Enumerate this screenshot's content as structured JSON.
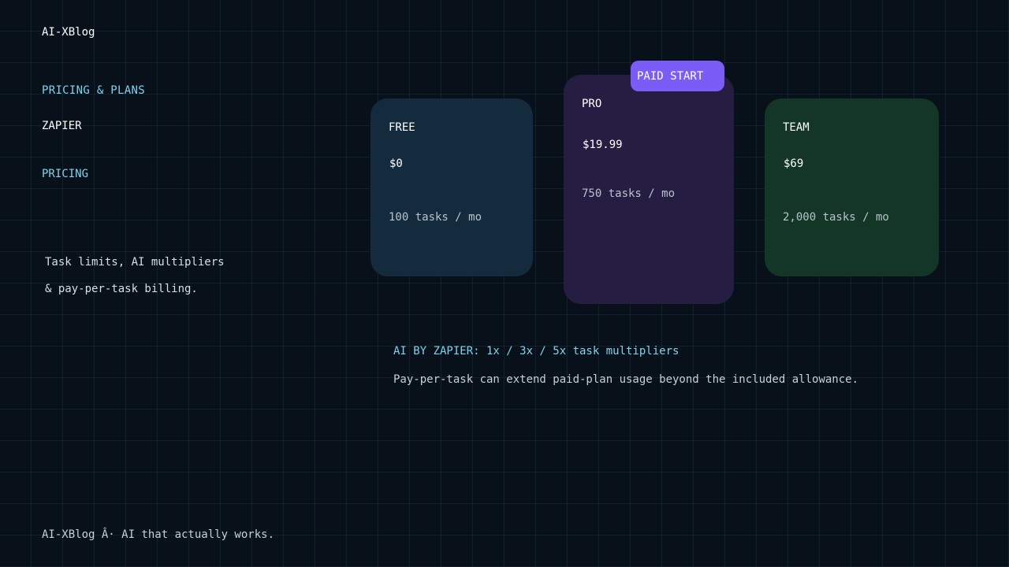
{
  "brand": {
    "name": "AI-XBlog"
  },
  "sidebar": {
    "kicker": "PRICING & PLANS",
    "title_line1": "ZAPIER",
    "title_line2": "PRICING",
    "description_lines": [
      "Task limits, AI multipliers",
      "& pay-per-task billing."
    ]
  },
  "plans": [
    {
      "name": "FREE",
      "price": "$0",
      "tasks": "100 tasks / mo",
      "color": "#142b3d"
    },
    {
      "name": "PRO",
      "price": "$19.99",
      "tasks": "750 tasks / mo",
      "color": "#261e42",
      "badge": "PAID START",
      "badge_color": "#7c5cf7"
    },
    {
      "name": "TEAM",
      "price": "$69",
      "tasks": "2,000 tasks / mo",
      "color": "#133626"
    }
  ],
  "ai_note": {
    "heading": "AI BY ZAPIER: 1x / 3x / 5x task multipliers",
    "body": "Pay-per-task can extend paid-plan usage beyond the included allowance."
  },
  "footer": {
    "text": "AI-XBlog Â· AI that actually works."
  },
  "colors": {
    "background": "#08111a",
    "accent": "#7fd3ee",
    "text": "#ffffff",
    "muted": "#c5d0d8"
  }
}
